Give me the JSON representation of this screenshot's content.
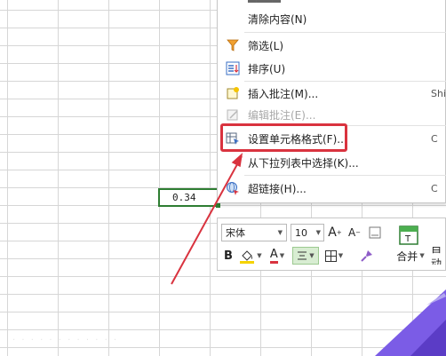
{
  "context_menu": {
    "items": [
      {
        "label": "清除内容(N)",
        "shortcut": ""
      },
      {
        "label": "筛选(L)",
        "shortcut": ""
      },
      {
        "label": "排序(U)",
        "shortcut": ""
      },
      {
        "label": "插入批注(M)...",
        "shortcut": "Shi"
      },
      {
        "label": "编辑批注(E)...",
        "shortcut": ""
      },
      {
        "label": "设置单元格格式(F)...",
        "shortcut": "C"
      },
      {
        "label": "从下拉列表中选择(K)...",
        "shortcut": ""
      },
      {
        "label": "超链接(H)...",
        "shortcut": "C"
      }
    ]
  },
  "cell": {
    "value": "0.34"
  },
  "mini_toolbar": {
    "font_name": "宋体",
    "font_size": "10",
    "bold": "B",
    "font_color_glyph": "A",
    "grow_font": "A",
    "shrink_font": "A",
    "merge_label": "合并",
    "autosum_label": "自动"
  },
  "colors": {
    "highlight": "#d9333f",
    "cell_border": "#2e7d32",
    "arrow": "#d9333f",
    "purple": "#7b5ce6"
  }
}
